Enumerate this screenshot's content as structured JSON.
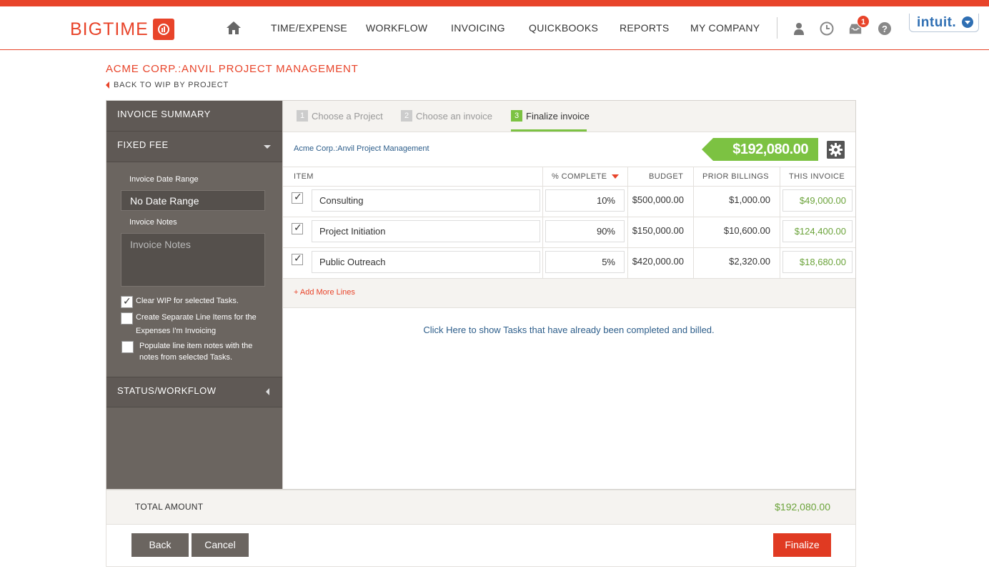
{
  "brand": {
    "logo_text": "BIGTIME",
    "partner": "intuit."
  },
  "nav": {
    "items": [
      "TIME/EXPENSE",
      "WORKFLOW",
      "INVOICING",
      "QUICKBOOKS",
      "REPORTS",
      "MY COMPANY"
    ],
    "notification_count": "1"
  },
  "page": {
    "title": "ACME CORP.:ANVIL PROJECT MANAGEMENT",
    "back_link": "BACK TO WIP BY PROJECT"
  },
  "sidebar": {
    "invoice_summary": "INVOICE SUMMARY",
    "fixed_fee": "FIXED FEE",
    "date_range_label": "Invoice Date Range",
    "date_range_value": "No Date Range",
    "notes_label": "Invoice Notes",
    "notes_placeholder": "Invoice Notes",
    "options": [
      {
        "label_line1": "Clear WIP for selected Tasks.",
        "label_line2": "",
        "checked": true
      },
      {
        "label_line1": "Create Separate Line Items for the",
        "label_line2": "Expenses I'm Invoicing",
        "checked": false
      },
      {
        "label_line1": "Populate line item notes with the",
        "label_line2": "notes from selected Tasks.",
        "checked": false
      }
    ],
    "status_workflow": "STATUS/WORKFLOW"
  },
  "steps": [
    {
      "num": "1",
      "label": "Choose a Project",
      "active": false
    },
    {
      "num": "2",
      "label": "Choose an invoice",
      "active": false
    },
    {
      "num": "3",
      "label": "Finalize invoice",
      "active": true
    }
  ],
  "invoice": {
    "project_link": "Acme Corp.:Anvil Project Management",
    "amount": "$192,080.00",
    "columns": [
      "ITEM",
      "% COMPLETE",
      "BUDGET",
      "PRIOR BILLINGS",
      "THIS INVOICE"
    ],
    "rows": [
      {
        "item": "Consulting",
        "pct": "10%",
        "budget": "$500,000.00",
        "prior": "$1,000.00",
        "this": "$49,000.00"
      },
      {
        "item": "Project Initiation",
        "pct": "90%",
        "budget": "$150,000.00",
        "prior": "$10,600.00",
        "this": "$124,400.00"
      },
      {
        "item": "Public Outreach",
        "pct": "5%",
        "budget": "$420,000.00",
        "prior": "$2,320.00",
        "this": "$18,680.00"
      }
    ],
    "add_lines": "+ Add More Lines",
    "show_tasks": "Click Here to show Tasks that have already been completed and billed."
  },
  "total": {
    "label": "TOTAL AMOUNT",
    "value": "$192,080.00"
  },
  "buttons": {
    "back": "Back",
    "cancel": "Cancel",
    "finalize": "Finalize"
  },
  "colors": {
    "accent": "#e8442a",
    "green": "#7cc242",
    "sidebar": "#6b6560"
  }
}
